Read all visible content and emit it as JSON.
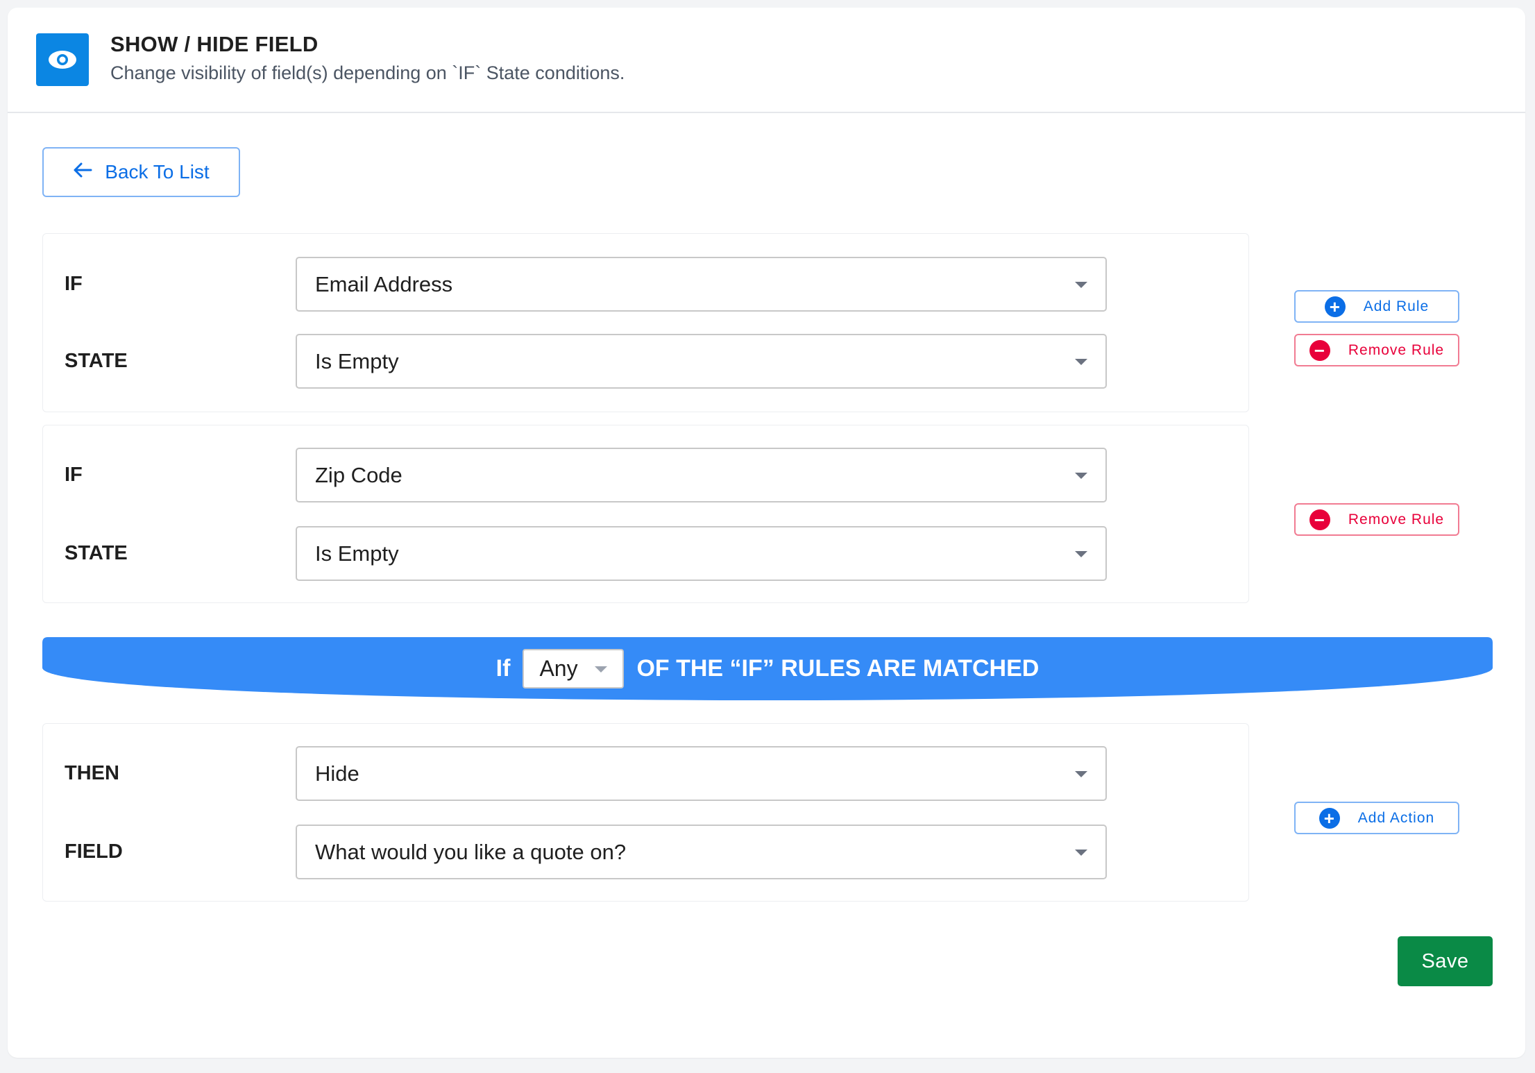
{
  "header": {
    "icon": "eye-icon",
    "title": "SHOW / HIDE FIELD",
    "subtitle": "Change visibility of field(s) depending on `IF` State conditions."
  },
  "back_button": {
    "label": "Back To List",
    "icon": "arrow-left-icon"
  },
  "rules": [
    {
      "if_label": "IF",
      "if_value": "Email Address",
      "state_label": "STATE",
      "state_value": "Is Empty"
    },
    {
      "if_label": "IF",
      "if_value": "Zip Code",
      "state_label": "STATE",
      "state_value": "Is Empty"
    }
  ],
  "rule_buttons": {
    "add_rule": "Add Rule",
    "remove_rule": "Remove Rule"
  },
  "match_banner": {
    "prefix": "If",
    "selected": "Any",
    "suffix": "OF THE “IF” RULES ARE MATCHED"
  },
  "action": {
    "then_label": "THEN",
    "then_value": "Hide",
    "field_label": "FIELD",
    "field_value": "What would you like a quote on?"
  },
  "add_action": "Add Action",
  "save": "Save",
  "colors": {
    "primary": "#0b6ee6",
    "banner": "#358bf7",
    "danger": "#e8003a",
    "save": "#0a8a46",
    "header_icon": "#0b86e3"
  }
}
